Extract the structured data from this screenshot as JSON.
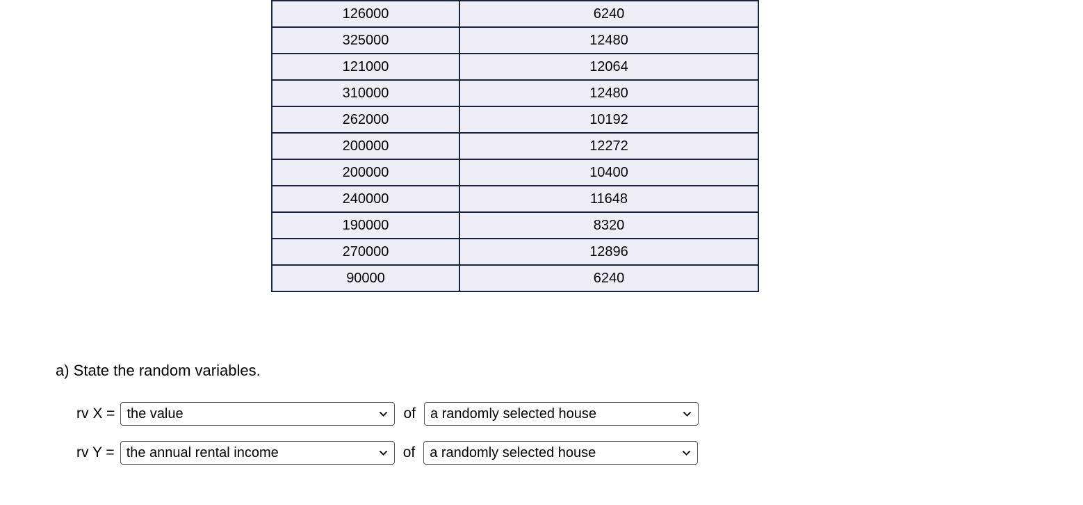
{
  "table": {
    "rows": [
      {
        "c1": "126000",
        "c2": "6240"
      },
      {
        "c1": "325000",
        "c2": "12480"
      },
      {
        "c1": "121000",
        "c2": "12064"
      },
      {
        "c1": "310000",
        "c2": "12480"
      },
      {
        "c1": "262000",
        "c2": "10192"
      },
      {
        "c1": "200000",
        "c2": "12272"
      },
      {
        "c1": "200000",
        "c2": "10400"
      },
      {
        "c1": "240000",
        "c2": "11648"
      },
      {
        "c1": "190000",
        "c2": "8320"
      },
      {
        "c1": "270000",
        "c2": "12896"
      },
      {
        "c1": "90000",
        "c2": "6240"
      }
    ]
  },
  "question_a": "a) State the random variables.",
  "rvX": {
    "label": "rv X =",
    "select1": "the value",
    "of": "of",
    "select2": "a randomly selected house"
  },
  "rvY": {
    "label": "rv Y =",
    "select1": "the annual rental income",
    "of": "of",
    "select2": "a randomly selected house"
  }
}
